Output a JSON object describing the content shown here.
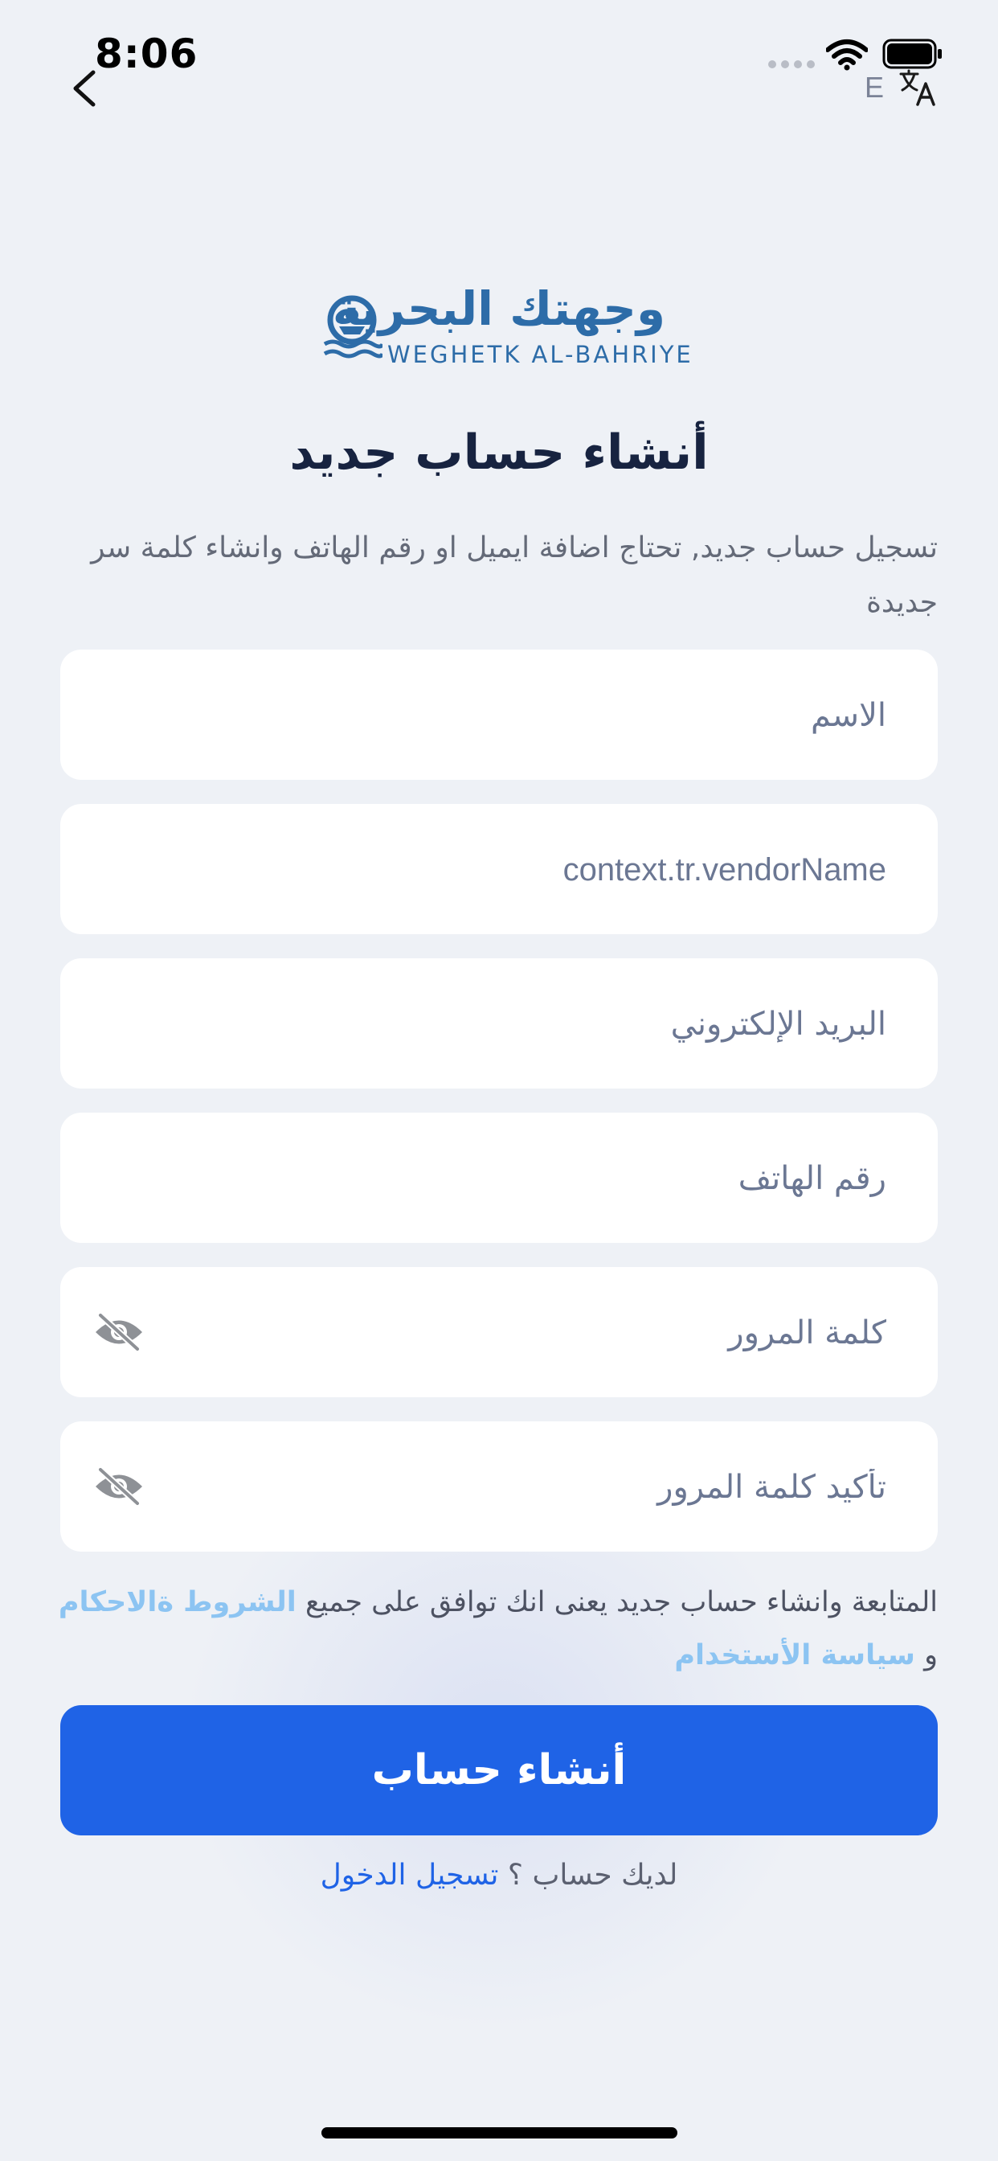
{
  "status_bar": {
    "time": "8:06"
  },
  "language": {
    "code": "E"
  },
  "logo": {
    "arabic": "وجهتك البحرية",
    "english": "WEGHETK AL-BAHRIYE"
  },
  "page": {
    "title": "أنشاء حساب جديد",
    "description": "تسجيل حساب جديد, تحتاج اضافة ايميل او رقم الهاتف وانشاء كلمة سر جديدة"
  },
  "form": {
    "name_placeholder": "الاسم",
    "vendor_placeholder": "context.tr.vendorName",
    "email_placeholder": "البريد الإلكتروني",
    "phone_placeholder": "رقم الهاتف",
    "password_placeholder": "كلمة المرور",
    "confirm_password_placeholder": "تأكيد كلمة المرور"
  },
  "terms": {
    "text": "المتابعة وانشاء حساب جديد يعنى انك توافق على جميع",
    "terms_link": "الشروط ةالاحكام",
    "and": "و",
    "privacy_link": "سياسة الأستخدام"
  },
  "submit": {
    "label": "أنشاء حساب"
  },
  "login": {
    "question": "لديك حساب ؟",
    "link": "تسجيل الدخول"
  },
  "colors": {
    "primary": "#1F63E6",
    "link_light": "#8CC4F2",
    "title": "#172340",
    "brand": "#2D6CA8",
    "background": "#EEF1F6"
  },
  "icons": {
    "back": "chevron-left-icon",
    "wifi": "wifi-icon",
    "battery": "battery-icon",
    "translate": "translate-icon",
    "password_toggle": "eye-slash-icon"
  }
}
